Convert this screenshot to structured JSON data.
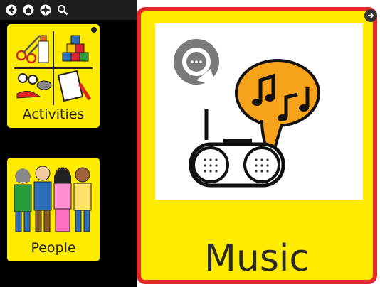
{
  "toolbar": {
    "items": [
      "back-icon",
      "home-icon",
      "settings-icon",
      "search-icon"
    ]
  },
  "cards": [
    {
      "label": "Activities",
      "icon": "activities-icon"
    },
    {
      "label": "People",
      "icon": "people-icon"
    }
  ],
  "selected_card": {
    "label": "Music",
    "icon": "music-icon",
    "border_color": "#e32a2a",
    "background_color": "#ffeb00"
  },
  "colors": {
    "card_yellow": "#ffeb00",
    "panel_black": "#000000",
    "highlight_red": "#e32a2a",
    "bubble_orange": "#f6a21a"
  }
}
